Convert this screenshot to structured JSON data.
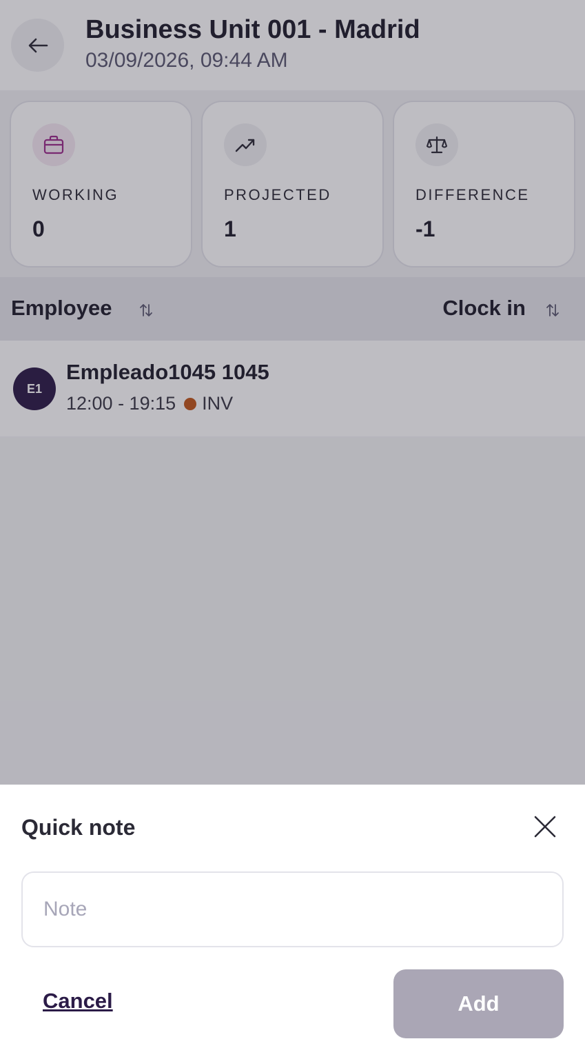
{
  "header": {
    "title": "Business Unit 001 - Madrid",
    "subtitle": "03/09/2026, 09:44 AM"
  },
  "stats": [
    {
      "label": "WORKING",
      "value": "0",
      "icon": "briefcase-icon",
      "icon_color": "#9b2a8a",
      "icon_bg": "#f5e8f3"
    },
    {
      "label": "PROJECTED",
      "value": "1",
      "icon": "trending-up-icon",
      "icon_color": "#2b2a36",
      "icon_bg": "#efeff3"
    },
    {
      "label": "DIFFERENCE",
      "value": "-1",
      "icon": "scale-icon",
      "icon_color": "#2b2a36",
      "icon_bg": "#efeff3"
    }
  ],
  "table": {
    "columns": [
      "Employee",
      "Clock in"
    ]
  },
  "employees": [
    {
      "initials": "E1",
      "name": "Empleado1045 1045",
      "shift": "12:00 - 19:15",
      "status": "INV",
      "status_color": "#c0561a"
    }
  ],
  "quick_note": {
    "title": "Quick note",
    "placeholder": "Note",
    "value": "",
    "cancel_label": "Cancel",
    "add_label": "Add"
  }
}
